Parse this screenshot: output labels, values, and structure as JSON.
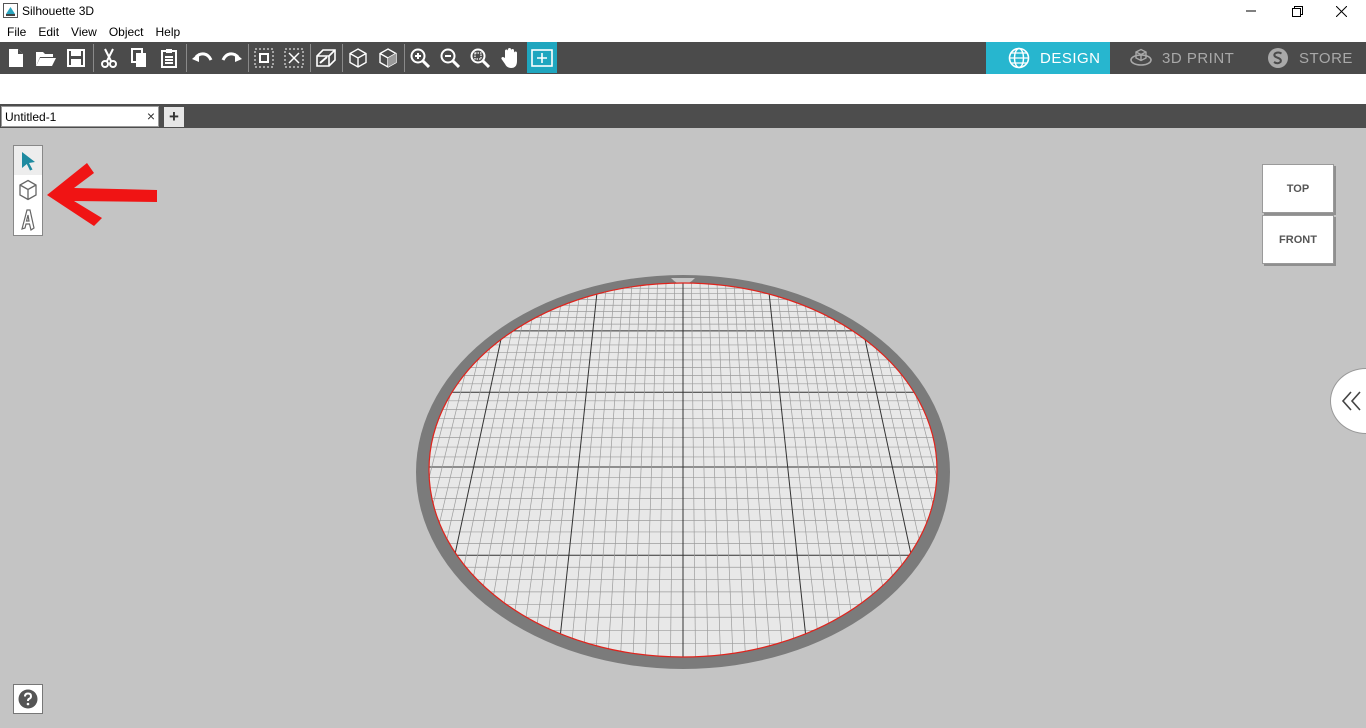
{
  "window": {
    "title": "Silhouette 3D",
    "controls": [
      "minimize-icon",
      "restore-icon",
      "close-icon"
    ]
  },
  "menu": [
    "File",
    "Edit",
    "View",
    "Object",
    "Help"
  ],
  "toolbar": {
    "tools": [
      "new-file-icon",
      "open-folder-icon",
      "save-icon",
      "cut-icon",
      "copy-icon",
      "paste-icon",
      "undo-icon",
      "redo-icon",
      "group-icon",
      "ungroup-icon",
      "extrude-icon",
      "cube-outline-icon",
      "cube-solid-icon",
      "zoom-in-icon",
      "zoom-out-icon",
      "zoom-fit-icon",
      "pan-hand-icon",
      "fit-page-icon"
    ],
    "active_tool": "fit-page-icon"
  },
  "modes": [
    {
      "label": "DESIGN",
      "icon": "globe-icon",
      "active": true
    },
    {
      "label": "3D PRINT",
      "icon": "print-bed-icon",
      "active": false
    },
    {
      "label": "STORE",
      "icon": "store-s-icon",
      "active": false
    }
  ],
  "tabs": [
    {
      "label": "Untitled-1",
      "close": "×"
    }
  ],
  "add_tab": "+",
  "left_tools": [
    "select-arrow-icon",
    "cube-tool-icon",
    "text-tool-icon"
  ],
  "view_cube": {
    "top": "TOP",
    "front": "FRONT"
  },
  "colors": {
    "toolbar_bg": "#4b4b4b",
    "accent": "#27b6cf",
    "canvas_bg": "#c4c4c4",
    "bed_border": "#7a7a7a",
    "bed_edge": "#e0231c",
    "annotation_arrow": "#f01414"
  }
}
